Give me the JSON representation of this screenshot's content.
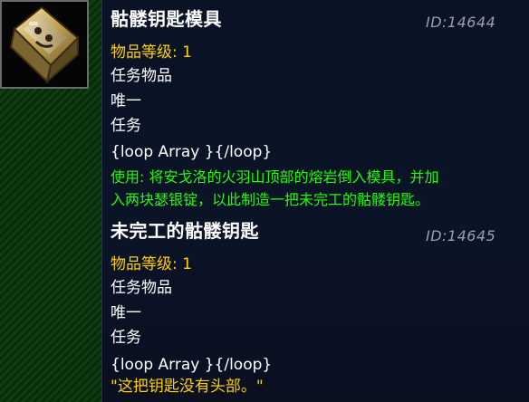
{
  "icon": {
    "name": "skull-key-mold-icon"
  },
  "items": [
    {
      "name": "骷髅钥匙模具",
      "id": "ID:14644",
      "item_level": "物品等级: 1",
      "type": "任务物品",
      "unique": "唯一",
      "category": "任务",
      "loop": "{loop Array }{/loop}",
      "use_line1": "使用: 将安戈洛的火羽山顶部的熔岩倒入模具，并加",
      "use_line2": "入两块瑟银锭，以此制造一把未完工的骷髅钥匙。"
    },
    {
      "name": "未完工的骷髅钥匙",
      "id": "ID:14645",
      "item_level": "物品等级: 1",
      "type": "任务物品",
      "unique": "唯一",
      "category": "任务",
      "loop": "{loop Array }{/loop}",
      "flavor": "\"这把钥匙没有头部。\""
    }
  ],
  "colors": {
    "title": "#ffffff",
    "item_level": "#ffd000",
    "use_text": "#1eff00",
    "flavor": "#ffd000",
    "id_text": "#9aa0aa"
  }
}
